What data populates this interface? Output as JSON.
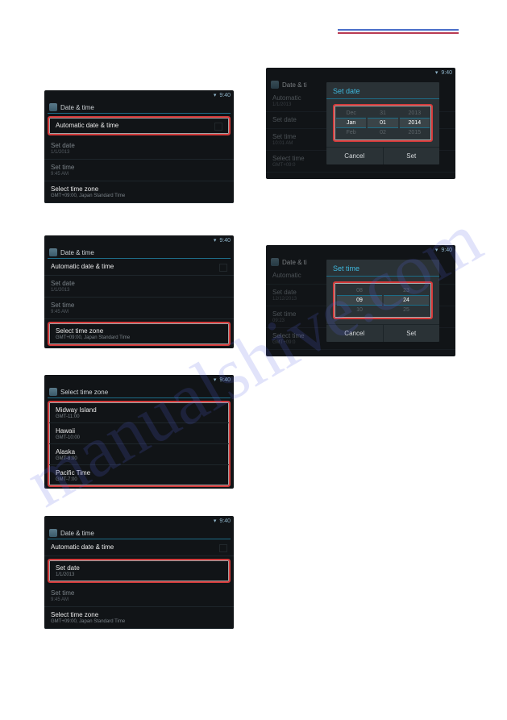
{
  "watermark": "manualshive.com",
  "statusbar": {
    "time": "9:40",
    "wifi_icon": "▾"
  },
  "screens": {
    "s1": {
      "header": "Date & time",
      "items": [
        {
          "title": "Automatic date & time",
          "sub": ""
        },
        {
          "title": "Set date",
          "sub": "1/1/2013"
        },
        {
          "title": "Set time",
          "sub": "9:45 AM"
        },
        {
          "title": "Select time zone",
          "sub": "GMT+09:00, Japan Standard Time"
        }
      ]
    },
    "s2_dialog": {
      "bg_header": "Date & ti",
      "bg_items": [
        {
          "title": "Automatic",
          "sub": "1/1/2013"
        },
        {
          "title": "Set date",
          "sub": ""
        },
        {
          "title": "Set time",
          "sub": "10:01 AM"
        },
        {
          "title": "Select time",
          "sub": "GMT+09:0"
        }
      ],
      "title": "Set date",
      "picker": {
        "top": [
          "Dec",
          "31",
          "2013"
        ],
        "center": [
          "Jan",
          "01",
          "2014"
        ],
        "bottom": [
          "Feb",
          "02",
          "2015"
        ]
      },
      "buttons": {
        "cancel": "Cancel",
        "set": "Set"
      }
    },
    "s3": {
      "header": "Date & time",
      "items": [
        {
          "title": "Automatic date & time",
          "sub": ""
        },
        {
          "title": "Set date",
          "sub": "1/1/2013"
        },
        {
          "title": "Set time",
          "sub": "9:45 AM"
        },
        {
          "title": "Select time zone",
          "sub": "GMT+09:00, Japan Standard Time"
        }
      ]
    },
    "s4_dialog": {
      "bg_header": "Date & ti",
      "bg_items": [
        {
          "title": "Automatic",
          "sub": ""
        },
        {
          "title": "Set date",
          "sub": "12/12/2013"
        },
        {
          "title": "Set time",
          "sub": "09:23"
        },
        {
          "title": "Select time",
          "sub": "GMT+09:0"
        }
      ],
      "title": "Set time",
      "picker": {
        "top": [
          "08",
          "23"
        ],
        "center": [
          "09",
          "24"
        ],
        "bottom": [
          "10",
          "25"
        ]
      },
      "buttons": {
        "cancel": "Cancel",
        "set": "Set"
      }
    },
    "s5": {
      "header": "Select time zone",
      "items": [
        {
          "title": "Midway Island",
          "sub": "GMT-11:00"
        },
        {
          "title": "Hawaii",
          "sub": "GMT-10:00"
        },
        {
          "title": "Alaska",
          "sub": "GMT-8:00"
        },
        {
          "title": "Pacific Time",
          "sub": "GMT-7:00"
        }
      ]
    },
    "s6": {
      "header": "Date & time",
      "items": [
        {
          "title": "Automatic date & time",
          "sub": ""
        },
        {
          "title": "Set date",
          "sub": "1/1/2013"
        },
        {
          "title": "Set time",
          "sub": "9:45 AM"
        },
        {
          "title": "Select time zone",
          "sub": "GMT+09:00, Japan Standard Time"
        }
      ]
    }
  }
}
